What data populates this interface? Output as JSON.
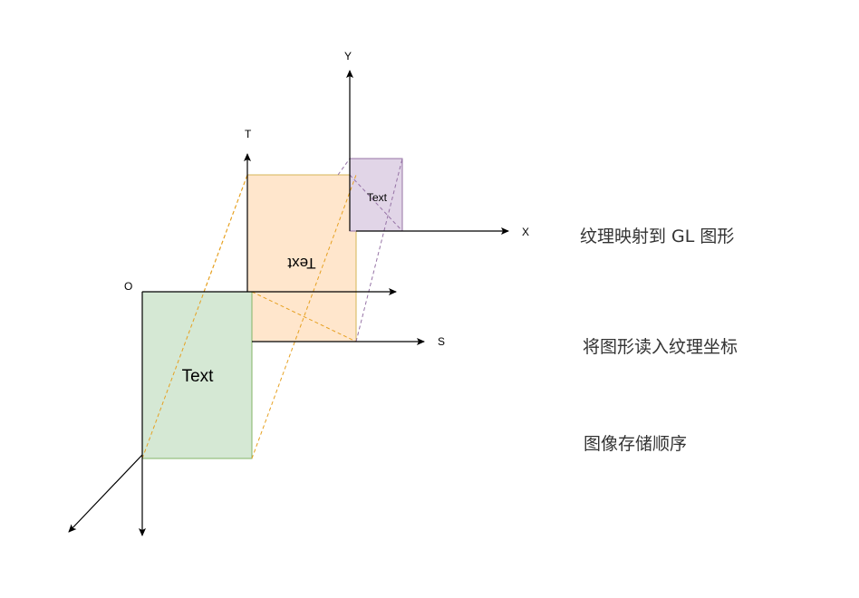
{
  "colors": {
    "green_fill": "#d5e8d4",
    "green_stroke": "#82b366",
    "orange_fill": "#ffe6cc",
    "orange_stroke": "#d6b656",
    "orange_dash": "#e6a020",
    "purple_fill": "#e1d5e7",
    "purple_stroke": "#9673a6",
    "purple_dash": "#9673a6",
    "axis": "#000000"
  },
  "axes": {
    "origin_label": "O",
    "t_label": "T",
    "s_label": "S",
    "x_label": "X",
    "y_label": "Y"
  },
  "boxes": {
    "image_text": "Text",
    "texture_text": "Text",
    "gl_text": "Text"
  },
  "captions": {
    "gl_mapping": "纹理映射到 GL 图形",
    "read_texture": "将图形读入纹理坐标",
    "storage_order": "图像存储顺序"
  }
}
